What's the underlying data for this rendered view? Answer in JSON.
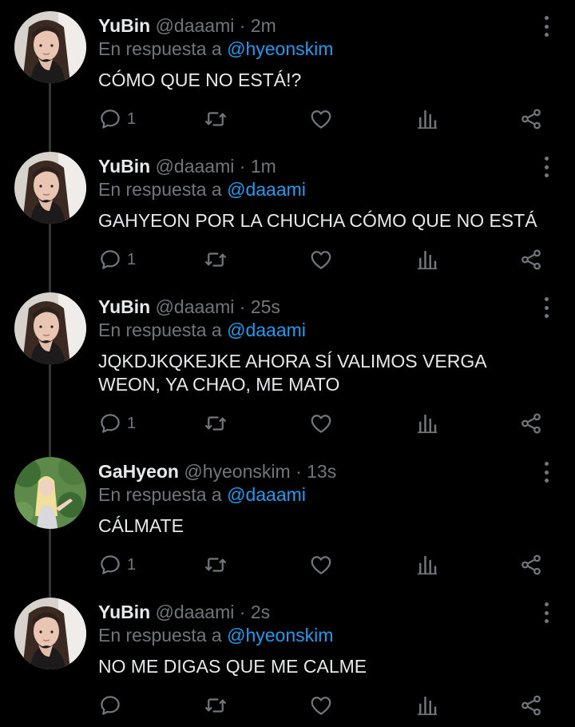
{
  "tweets": [
    {
      "display_name": "YuBin",
      "handle": "@daaami",
      "separator": "·",
      "time": "2m",
      "reply_prefix": "En respuesta a",
      "reply_to": "@hyeonskim",
      "text": "CÓMO QUE NO ESTÁ!?",
      "reply_count": "1",
      "avatar": "yubin-avatar"
    },
    {
      "display_name": "YuBin",
      "handle": "@daaami",
      "separator": "·",
      "time": "1m",
      "reply_prefix": "En respuesta a",
      "reply_to": "@daaami",
      "text": "GAHYEON POR LA CHUCHA CÓMO QUE NO ESTÁ",
      "reply_count": "1",
      "avatar": "yubin-avatar"
    },
    {
      "display_name": "YuBin",
      "handle": "@daaami",
      "separator": "·",
      "time": "25s",
      "reply_prefix": "En respuesta a",
      "reply_to": "@daaami",
      "text": "JQKDJKQKEJKE AHORA SÍ VALIMOS VERGA WEON, YA CHAO, ME MATO",
      "reply_count": "1",
      "avatar": "yubin-avatar"
    },
    {
      "display_name": "GaHyeon",
      "handle": "@hyeonskim",
      "separator": "·",
      "time": "13s",
      "reply_prefix": "En respuesta a",
      "reply_to": "@daaami",
      "text": "CÁLMATE",
      "reply_count": "1",
      "avatar": "gahyeon-avatar"
    },
    {
      "display_name": "YuBin",
      "handle": "@daaami",
      "separator": "·",
      "time": "2s",
      "reply_prefix": "En respuesta a",
      "reply_to": "@hyeonskim",
      "text": "NO ME DIGAS QUE ME CALME",
      "reply_count": "",
      "avatar": "yubin-avatar"
    }
  ],
  "icons": {
    "reply": "reply-icon",
    "retweet": "retweet-icon",
    "like": "heart-icon",
    "views": "analytics-icon",
    "share": "share-icon",
    "more": "more-icon"
  },
  "colors": {
    "background": "#000000",
    "primary_text": "#e7e9ea",
    "secondary_text": "#71767b",
    "mention": "#1d9bf0",
    "thread_line": "#333639"
  }
}
